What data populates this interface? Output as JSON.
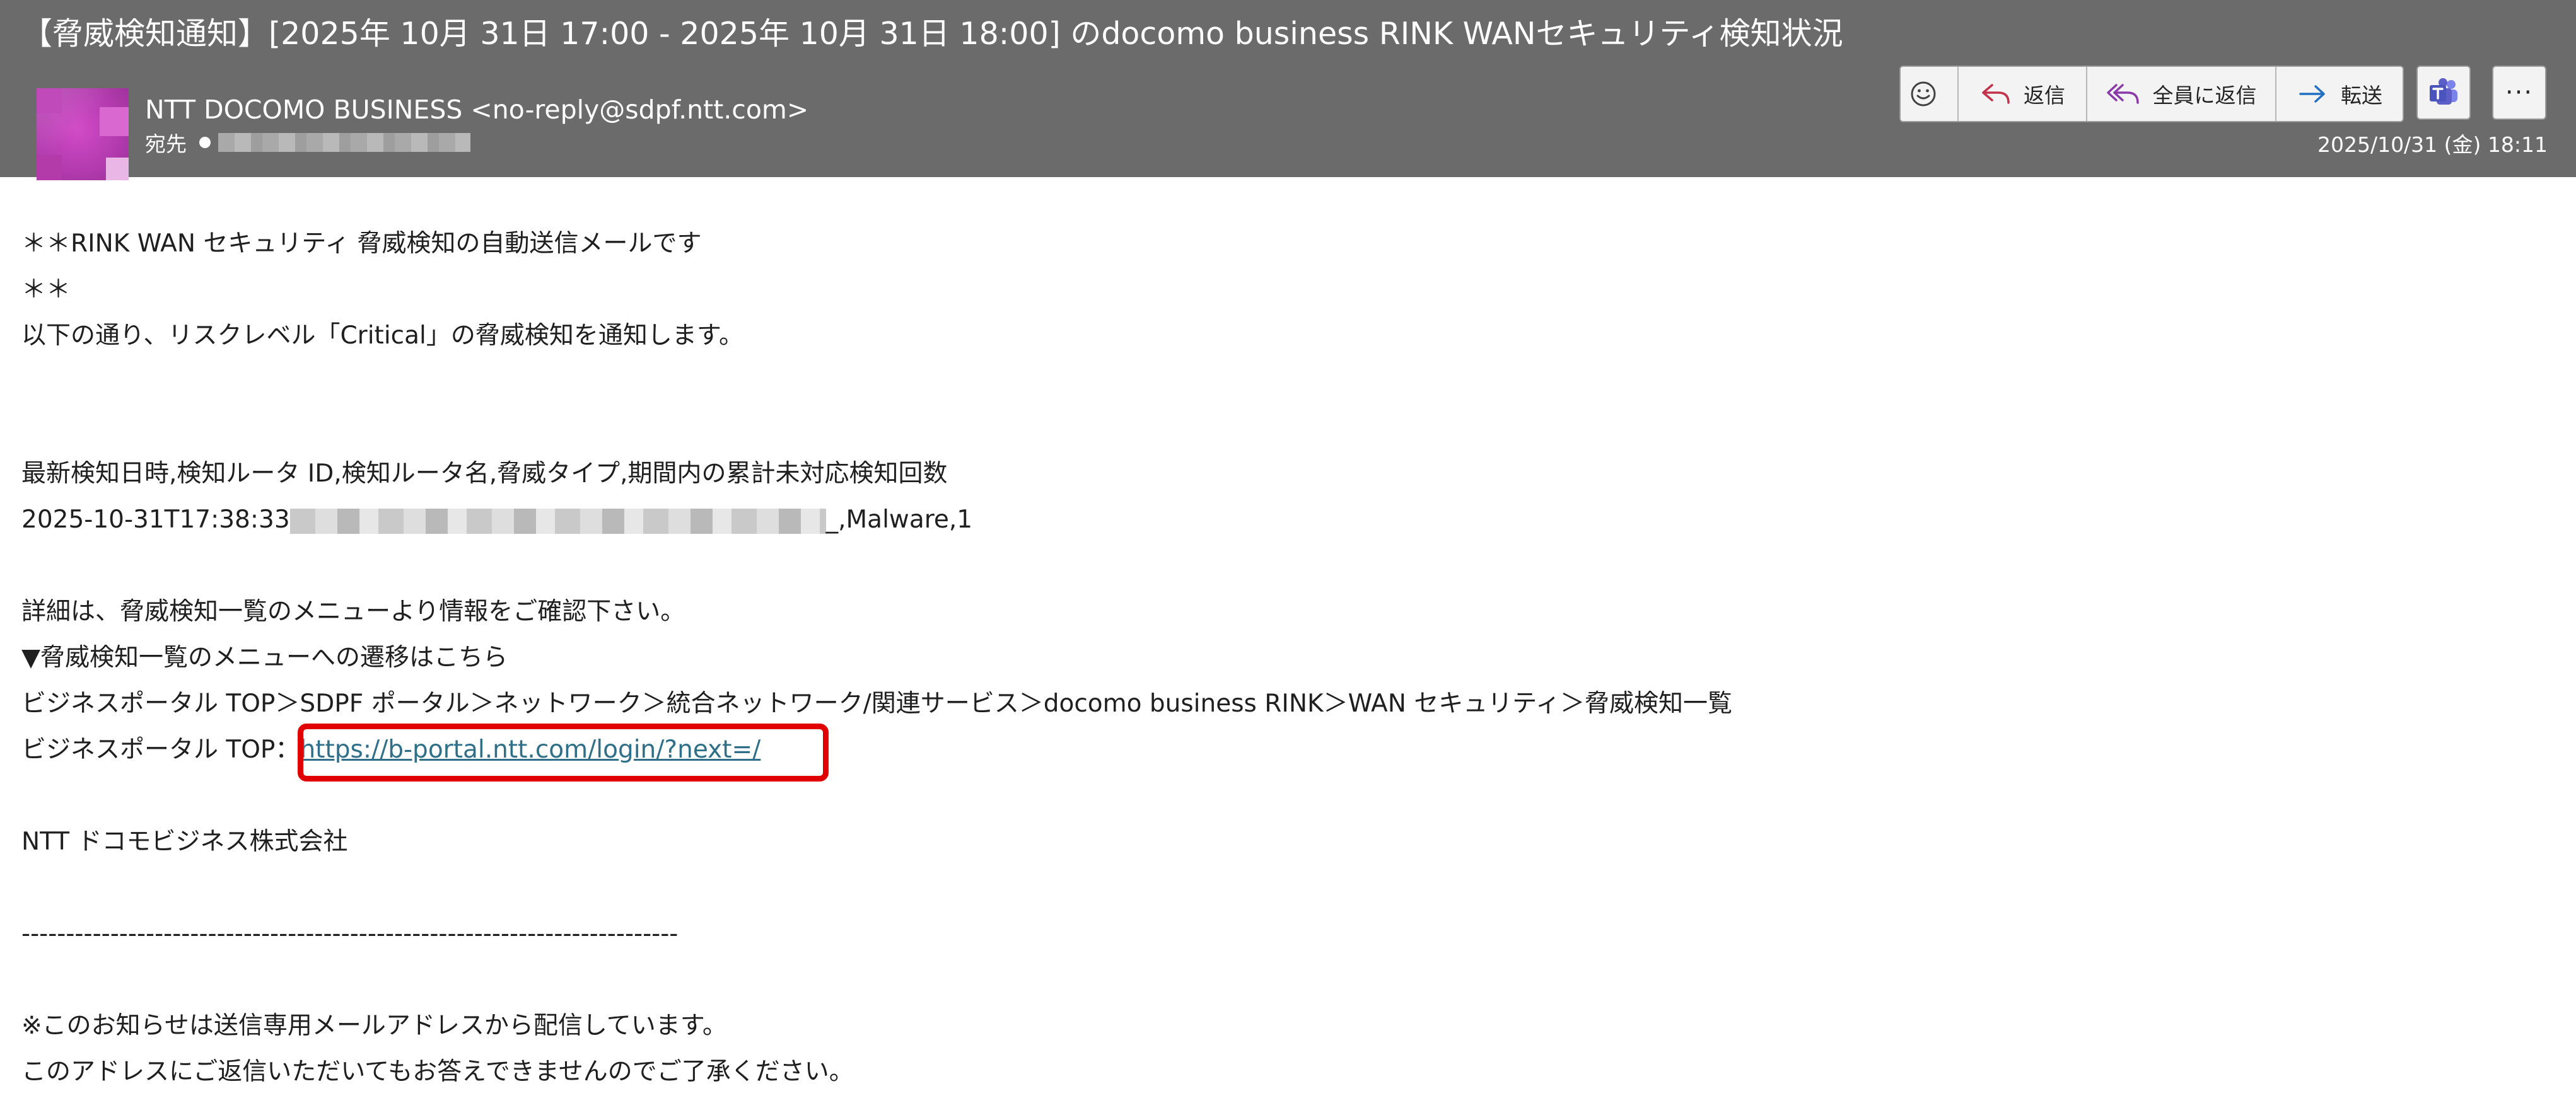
{
  "email": {
    "subject": "【脅威検知通知】[2025年 10月 31日 17:00 - 2025年 10月 31日 18:00] のdocomo business RINK WANセキュリティ検知状況",
    "sender": "NTT DOCOMO BUSINESS <no-reply@sdpf.ntt.com>",
    "to_label": "宛先",
    "datetime": "2025/10/31 (金) 18:11"
  },
  "toolbar": {
    "reply_label": "返信",
    "reply_all_label": "全員に返信",
    "forward_label": "転送",
    "more_label": "···"
  },
  "body": {
    "line1": "＊＊RINK WAN セキュリティ 脅威検知の自動送信メールです",
    "line2": "＊＊",
    "line3": "以下の通り、リスクレベル「Critical」の脅威検知を通知します。",
    "csv_header": "最新検知日時,検知ルータ ID,検知ルータ名,脅威タイプ,期間内の累計未対応検知回数",
    "csv_row_prefix": "2025-10-31T17:38:33",
    "csv_row_suffix": "_,Malware,1",
    "detail_line": "詳細は、脅威検知一覧のメニューより情報をご確認下さい。",
    "nav_title": "▼脅威検知一覧のメニューへの遷移はこちら",
    "nav_path": "ビジネスポータル TOP＞SDPF ポータル＞ネットワーク＞統合ネットワーク/関連サービス＞docomo business RINK＞WAN セキュリティ＞脅威検知一覧",
    "portal_label": "ビジネスポータル TOP：",
    "portal_link": "https://b-portal.ntt.com/login/?next=/",
    "company": "NTT ドコモビジネス株式会社",
    "divider": "--------------------------------------------------------------------------",
    "notice1": "※このお知らせは送信専用メールアドレスから配信しています。",
    "notice2": "このアドレスにご返信いただいてもお答えできませんのでご了承ください。"
  },
  "icons": {
    "emoji": "smiley-icon",
    "reply": "reply-arrow-icon",
    "reply_all": "reply-all-arrow-icon",
    "forward": "forward-arrow-icon",
    "teams": "teams-icon"
  },
  "colors": {
    "header_bg": "#6b6b6b",
    "link": "#2f6f8a",
    "highlight_box": "#e00000",
    "reply_arrow": "#c4314b",
    "reply_all_arrow": "#8a3aa8",
    "forward_arrow": "#1f6fc2",
    "teams": "#5b5fc7"
  }
}
